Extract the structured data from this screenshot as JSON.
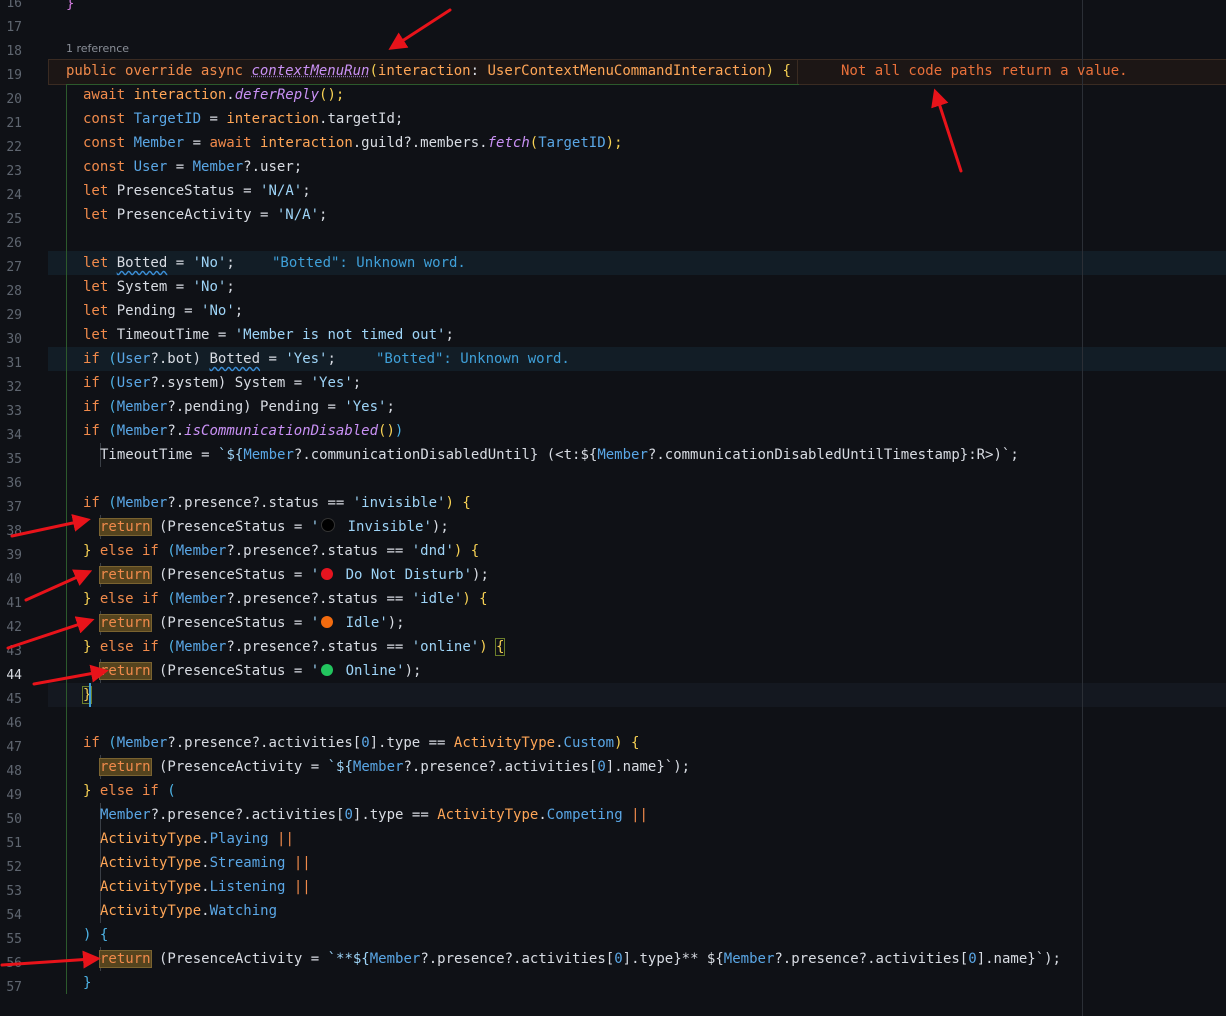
{
  "codelens": "1 reference",
  "line_numbers": [
    "16",
    "17",
    "18",
    "19",
    "20",
    "21",
    "22",
    "23",
    "24",
    "25",
    "26",
    "27",
    "28",
    "29",
    "30",
    "31",
    "32",
    "33",
    "34",
    "35",
    "36",
    "37",
    "38",
    "39",
    "40",
    "41",
    "42",
    "43",
    "44",
    "45",
    "46",
    "47",
    "48",
    "49",
    "50",
    "51",
    "52",
    "53",
    "54",
    "55",
    "56",
    "57"
  ],
  "current_line": "44",
  "diagnostics": {
    "not_all_paths": "Not all code paths return a value.",
    "botted_word_1": "\"Botted\": Unknown word.",
    "botted_word_2": "\"Botted\": Unknown word."
  },
  "code": {
    "l18": {
      "a": "public override async ",
      "fn": "contextMenuRun",
      "b": "(",
      "p": "interaction",
      "c": ": ",
      "ty": "UserContextMenuCommandInteraction",
      "d": ") {"
    },
    "l19": {
      "a": "await ",
      "b": "interaction",
      "c": ".",
      "fn": "deferReply",
      "d": "();"
    },
    "l20": {
      "a": "const ",
      "b": "TargetID",
      "c": " = ",
      "d": "interaction",
      ".e": ".",
      "e": ".targetId;"
    },
    "l21": {
      "a": "const ",
      "b": "Member",
      "c": " = ",
      "d": "await ",
      "e": "interaction",
      "f": ".guild?.members.",
      "fn": "fetch",
      "g": "(",
      "h": "TargetID",
      "i": ");"
    },
    "l22": {
      "a": "const ",
      "b": "User",
      "c": " = ",
      "d": "Member",
      "e": "?.user;"
    },
    "l23": {
      "a": "let ",
      "b": "PresenceStatus",
      "c": " = ",
      "s": "'N/A'",
      "d": ";"
    },
    "l24": {
      "a": "let ",
      "b": "PresenceActivity",
      "c": " = ",
      "s": "'N/A'",
      "d": ";"
    },
    "l26": {
      "a": "let ",
      "b": "Botted",
      "c": " = ",
      "s": "'No'",
      "d": ";"
    },
    "l27": {
      "a": "let ",
      "b": "System",
      "c": " = ",
      "s": "'No'",
      "d": ";"
    },
    "l28": {
      "a": "let ",
      "b": "Pending",
      "c": " = ",
      "s": "'No'",
      "d": ";"
    },
    "l29": {
      "a": "let ",
      "b": "TimeoutTime",
      "c": " = ",
      "s": "'Member is not timed out'",
      "d": ";"
    },
    "l30": {
      "a": "if ",
      "b": "(",
      "c": "User",
      "d": "?.bot) ",
      "e": "Botted",
      "f": " = ",
      "s": "'Yes'",
      "g": ";"
    },
    "l31": {
      "a": "if ",
      "b": "(",
      "c": "User",
      "d": "?.system) System = ",
      "s": "'Yes'",
      "g": ";"
    },
    "l32": {
      "a": "if ",
      "b": "(",
      "c": "Member",
      "d": "?.pending) Pending = ",
      "s": "'Yes'",
      "g": ";"
    },
    "l33": {
      "a": "if ",
      "b": "(",
      "c": "Member",
      "d": "?.",
      "fn": "isCommunicationDisabled",
      "e": "()",
      ")": ")"
    },
    "l34": {
      "a": "TimeoutTime = ",
      "s1": "`${",
      "m": "Member",
      "s2": "?.communicationDisabledUntil} (<t:${",
      "m2": "Member",
      "s3": "?.communicationDisabledUntilTimestamp}:R>)`",
      "d": ";"
    },
    "l36": {
      "a": "if ",
      "b": "(",
      "c": "Member",
      "d": "?.presence?.status == ",
      "s": "'invisible'",
      "e": ") {"
    },
    "l37": {
      "r": "return",
      "a": " (PresenceStatus = ",
      "s1": "'",
      "label": " Invisible'",
      "e": ");"
    },
    "l38": {
      "a": "} ",
      "k": "else if ",
      "b": "(",
      "c": "Member",
      "d": "?.presence?.status == ",
      "s": "'dnd'",
      "e": ") {"
    },
    "l39": {
      "r": "return",
      "a": " (PresenceStatus = ",
      "s1": "'",
      "label": " Do Not Disturb'",
      "e": ");"
    },
    "l40": {
      "a": "} ",
      "k": "else if ",
      "b": "(",
      "c": "Member",
      "d": "?.presence?.status == ",
      "s": "'idle'",
      "e": ") {"
    },
    "l41": {
      "r": "return",
      "a": " (PresenceStatus = ",
      "s1": "'",
      "label": " Idle'",
      "e": ");"
    },
    "l42": {
      "a": "} ",
      "k": "else if ",
      "b": "(",
      "c": "Member",
      "d": "?.presence?.status == ",
      "s": "'online'",
      "e": ") ",
      "br": "{"
    },
    "l43": {
      "r": "return",
      "a": " (PresenceStatus = ",
      "s1": "'",
      "label": " Online'",
      "e": ");"
    },
    "l44": {
      "a": "}"
    },
    "l46": {
      "a": "if ",
      "b": "(",
      "c": "Member",
      "d": "?.presence?.activities[",
      "n": "0",
      "e": "].type == ",
      "t": "ActivityType",
      ".": ".",
      "en": "Custom",
      "f": ") {"
    },
    "l47": {
      "r": "return",
      "a": " (PresenceActivity = ",
      "s1": "`${",
      "m": "Member",
      "s2": "?.presence?.activities[",
      "n": "0",
      "s3": "].name}`",
      "e": ");"
    },
    "l48": {
      "a": "} ",
      "k": "else if ",
      "b": "("
    },
    "l49": {
      "c": "Member",
      "d": "?.presence?.activities[",
      "n": "0",
      "e": "].type == ",
      "t": "ActivityType",
      ".": ".",
      "en": "Competing",
      "op": " ||"
    },
    "l50": {
      "t": "ActivityType",
      ".": ".",
      "en": "Playing",
      "op": " ||"
    },
    "l51": {
      "t": "ActivityType",
      ".": ".",
      "en": "Streaming",
      "op": " ||"
    },
    "l52": {
      "t": "ActivityType",
      ".": ".",
      "en": "Listening",
      "op": " ||"
    },
    "l53": {
      "t": "ActivityType",
      ".": ".",
      "en": "Watching"
    },
    "l54": {
      "a": ") {"
    },
    "l55": {
      "r": "return",
      "a": " (PresenceActivity = ",
      "s1": "`**${",
      "m": "Member",
      "s2": "?.presence?.activities[",
      "n": "0",
      "s3": "].type}** ${",
      "m2": "Member",
      "s4": "?.presence?.activities[",
      "n2": "0",
      "s5": "].name}`",
      "e": ");"
    },
    "l56": {
      "a": "}"
    }
  },
  "colors": {
    "background": "#0f1116",
    "keyword": "#f08a4b",
    "variable": "#5aa7e6",
    "function": "#c991f5",
    "string": "#9ed4f7",
    "type": "#ffa657",
    "error_text": "#e9703a",
    "lint_text": "#3fa0d9",
    "dot_invisible": "#000000",
    "dot_dnd": "#e5141f",
    "dot_idle": "#f26b0f",
    "dot_online": "#22c55e",
    "annotation_arrow": "#e8131a"
  }
}
